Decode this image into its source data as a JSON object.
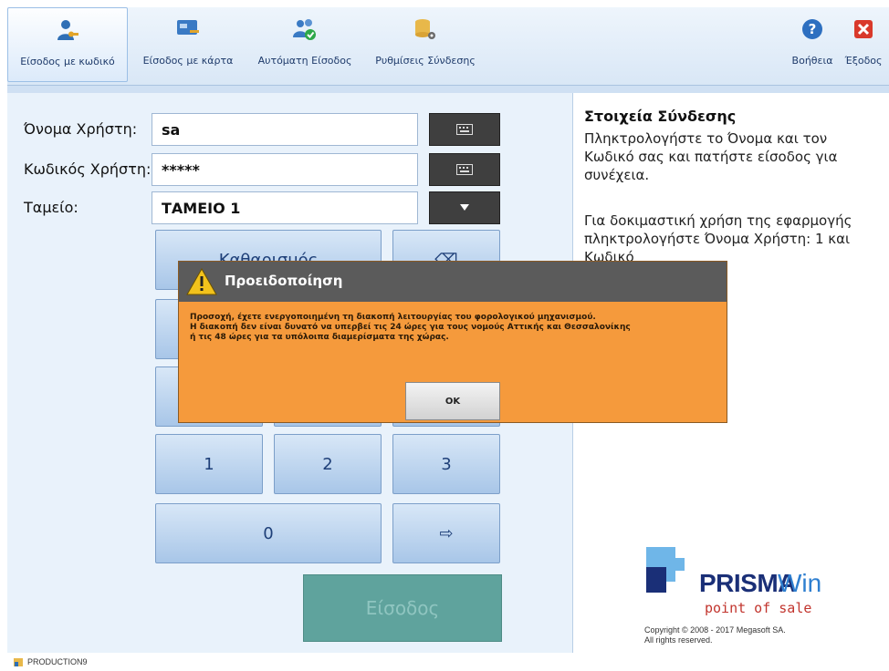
{
  "ribbon": {
    "login_code": "Είσοδος με κωδικό",
    "login_card": "Είσοδος με κάρτα",
    "auto_login": "Αυτόματη Είσοδος",
    "connection_settings": "Ρυθμίσεις Σύνδεσης",
    "help": "Βοήθεια",
    "exit": "Έξοδος"
  },
  "form": {
    "username_label": "Όνομα Χρήστη:",
    "username_value": "sa",
    "password_label": "Κωδικός Χρήστη:",
    "password_value": "*****",
    "register_label": "Ταμείο:",
    "register_value": "ΤΑΜΕΙΟ 1"
  },
  "keypad": {
    "clear": "Καθαρισμός",
    "backspace_symbol": "⌫",
    "k1": "1",
    "k2": "2",
    "k3": "3",
    "k0": "0",
    "arrow": "⇨"
  },
  "enter_button": "Είσοδος",
  "info": {
    "title": "Στοιχεία Σύνδεσης",
    "p1": "Πληκτρολογήστε το Όνομα και τον Κωδικό σας και πατήστε είσοδος για συνέχεια.",
    "p2": "Για δοκιμαστική χρήση της εφαρμογής πληκτρολογήστε Όνομα Χρήστη: 1 και Κωδικό"
  },
  "logo": {
    "brand": "PRISMA",
    "brand_suffix": "Win",
    "tagline": "point of sale",
    "copyright_1": "Copyright © 2008 - 2017 Megasoft SA.",
    "copyright_2": "All rights reserved."
  },
  "dialog": {
    "title": "Προειδοποίηση",
    "line1": "Προσοχή, έχετε ενεργοποιημένη τη διακοπή λειτουργίας του φορολογικού μηχανισμού.",
    "line2": "Η διακοπή δεν είναι δυνατό να υπερβεί τις 24 ώρες για τους νομούς Αττικής και Θεσσαλονίκης",
    "line3": "ή τις 48 ώρες για τα υπόλοιπα διαμερίσματα της χώρας.",
    "ok": "OK"
  },
  "status": {
    "production": "PRODUCTION9"
  },
  "colors": {
    "accent": "#1e3f78",
    "enter_bg": "#5fa39d",
    "dialog_bg": "#f59a3c",
    "dialog_head": "#5b5b5b"
  }
}
